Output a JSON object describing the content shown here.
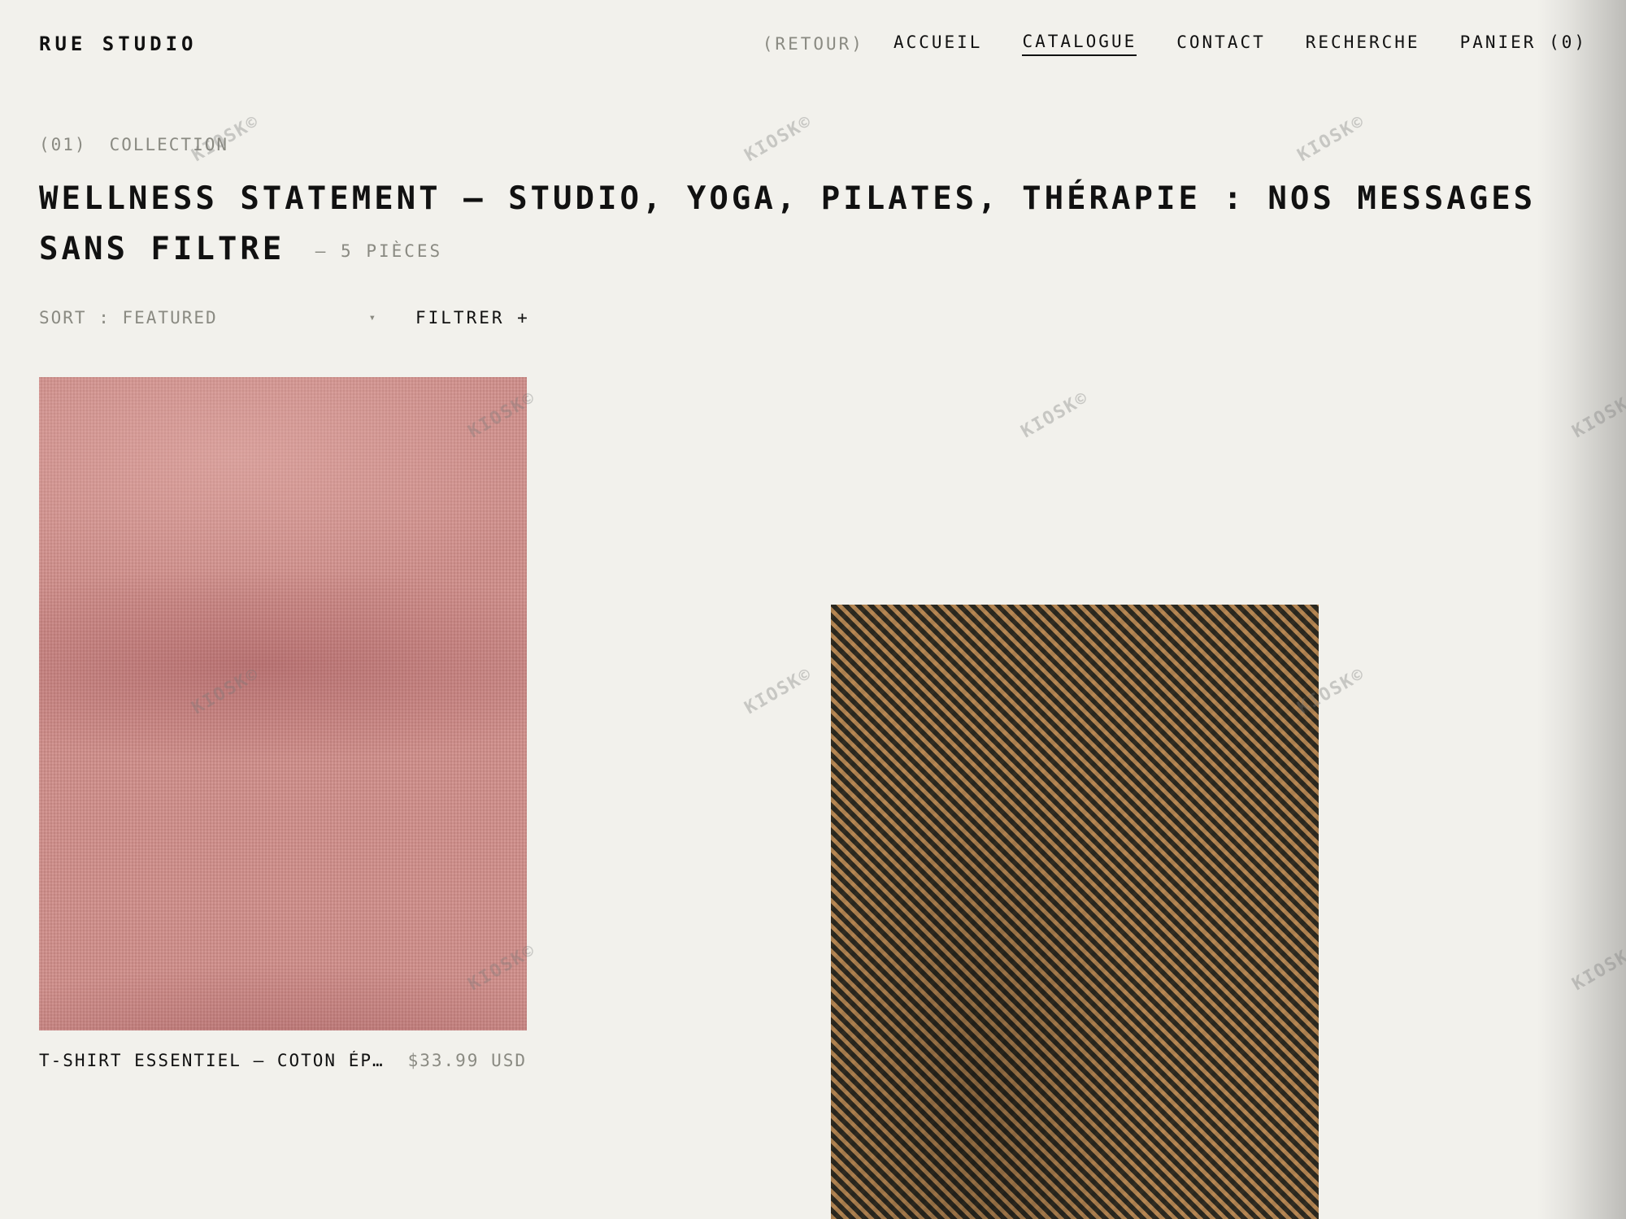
{
  "header": {
    "brand": "RUE STUDIO",
    "back_label": "(RETOUR)",
    "nav": [
      "ACCUEIL",
      "CATALOGUE",
      "CONTACT",
      "RECHERCHE",
      "PANIER (0)"
    ],
    "active_nav": "CATALOGUE"
  },
  "collection": {
    "index": "(01)",
    "label": "COLLECTION",
    "title": "WELLNESS STATEMENT – STUDIO, YOGA, PILATES, THÉRAPIE : NOS MESSAGES SANS FILTRE",
    "count": "— 5 PIÈCES"
  },
  "controls": {
    "sort_label": "SORT : FEATURED",
    "sort_caret": "▾",
    "filter_label": "FILTRER +"
  },
  "products": [
    {
      "name": "T-SHIRT ESSENTIEL — COTON ÉPA…",
      "price": "$33.99 USD",
      "image": "pink-heather-knit-fabric"
    },
    {
      "name": "",
      "price": "",
      "image": "brown-tweed-fabric"
    }
  ],
  "watermark": "KIOSK©",
  "colors": {
    "background": "#f2f1ec",
    "text": "#111111",
    "muted": "#8a8a82"
  }
}
